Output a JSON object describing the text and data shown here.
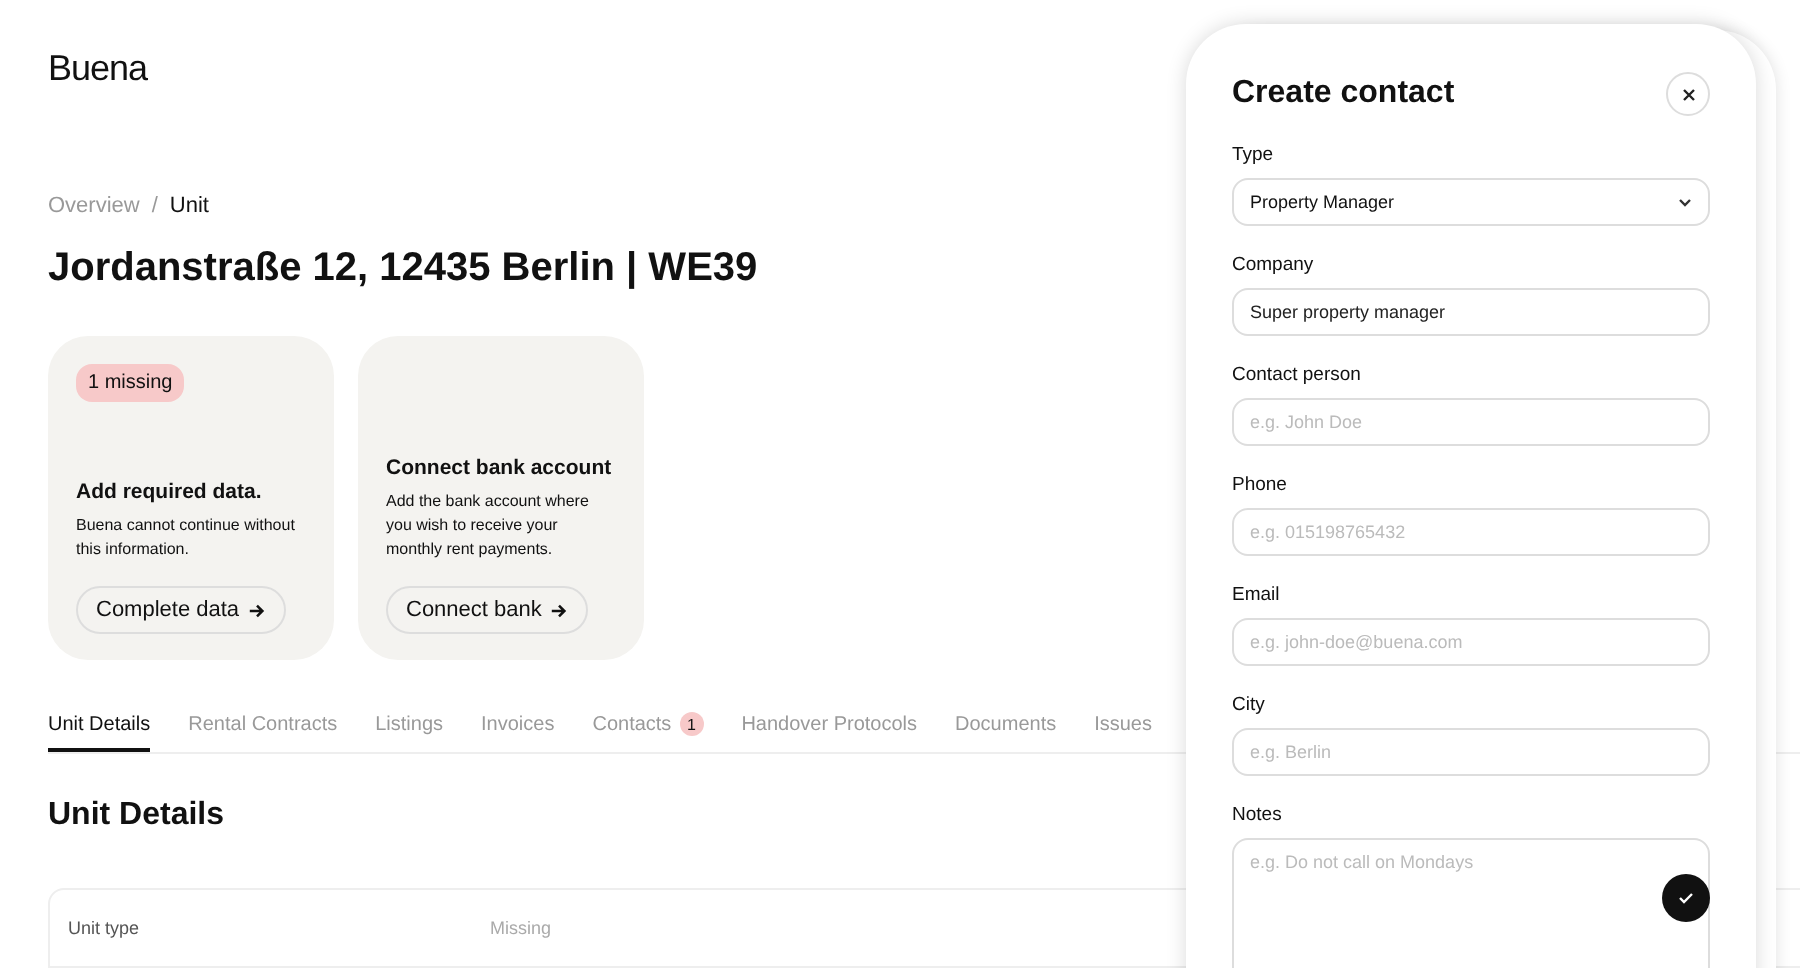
{
  "logo": "Buena",
  "breadcrumb_separator": "/",
  "breadcrumb": [
    {
      "label": "Overview",
      "current": false
    },
    {
      "label": "Unit",
      "current": true
    }
  ],
  "title": "Jordanstraße 12, 12435 Berlin | WE39",
  "cards": [
    {
      "badge": "1 missing",
      "heading": "Add required data.",
      "text": "Buena cannot continue without this information.",
      "button": "Complete data"
    },
    {
      "heading": "Connect bank account",
      "text": "Add the bank account where you wish to receive your monthly rent payments.",
      "button": "Connect bank"
    }
  ],
  "tabs": [
    {
      "label": "Unit Details",
      "selected": true
    },
    {
      "label": "Rental Contracts",
      "selected": false
    },
    {
      "label": "Listings",
      "selected": false
    },
    {
      "label": "Invoices",
      "selected": false
    },
    {
      "label": "Contacts",
      "selected": false,
      "count": "1"
    },
    {
      "label": "Handover Protocols",
      "selected": false
    },
    {
      "label": "Documents",
      "selected": false
    },
    {
      "label": "Issues",
      "selected": false
    }
  ],
  "section_title": "Unit Details",
  "table": {
    "rows": [
      {
        "label": "Unit type",
        "value": "Missing"
      }
    ]
  },
  "dialog": {
    "title": "Create contact",
    "fields": [
      {
        "kind": "select",
        "label": "Type",
        "value": "Property Manager"
      },
      {
        "kind": "text",
        "label": "Company",
        "value": "Super property manager"
      },
      {
        "kind": "text",
        "label": "Contact person",
        "placeholder": "e.g. John Doe"
      },
      {
        "kind": "text",
        "label": "Phone",
        "placeholder": "e.g. 015198765432"
      },
      {
        "kind": "text",
        "label": "Email",
        "placeholder": "e.g. john-doe@buena.com"
      },
      {
        "kind": "text",
        "label": "City",
        "placeholder": "e.g. Berlin"
      },
      {
        "kind": "textarea",
        "label": "Notes",
        "placeholder": "e.g. Do not call on Mondays"
      }
    ]
  }
}
